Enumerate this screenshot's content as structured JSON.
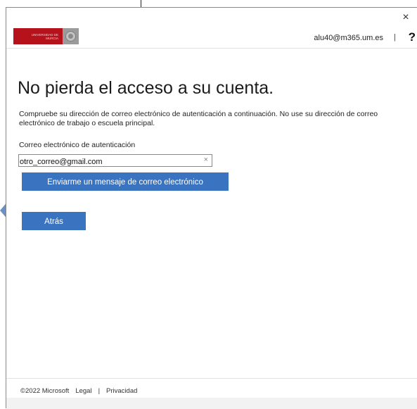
{
  "header": {
    "logo_text_line1": "UNIVERSIDAD DE",
    "logo_text_line2": "MURCIA",
    "user_email": "alu40@m365.um.es",
    "separator": "|",
    "help_label": "?"
  },
  "dialog": {
    "close_label": "×"
  },
  "main": {
    "title": "No pierda el acceso a su cuenta.",
    "description": "Compruebe su dirección de correo electrónico de autenticación a continuación. No use su dirección de correo electrónico de trabajo o escuela principal.",
    "field_label": "Correo electrónico de autenticación",
    "email_value": "otro_correo@gmail.com",
    "clear_label": "×",
    "send_button": "Enviarme un mensaje de correo electrónico",
    "back_button": "Atrás"
  },
  "footer": {
    "copyright": "©2022 Microsoft",
    "legal": "Legal",
    "separator": "|",
    "privacy": "Privacidad"
  },
  "colors": {
    "primary_button": "#3a73c0",
    "logo_red": "#b5121b",
    "logo_grey": "#9b9b9b"
  },
  "icons": {
    "close": "close-icon",
    "help": "help-icon",
    "clear": "clear-icon"
  }
}
